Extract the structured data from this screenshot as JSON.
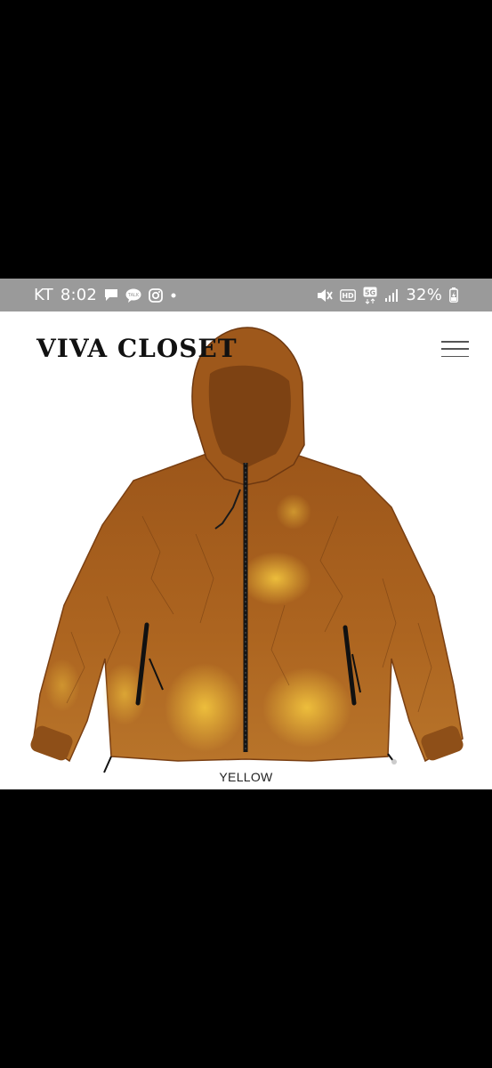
{
  "status_bar": {
    "carrier": "KT",
    "time": "8:02",
    "left_icons": [
      "chat-bubble-icon",
      "kakaotalk-icon",
      "instagram-icon",
      "dot-icon"
    ],
    "right_icons": [
      "mute-icon",
      "hd-icon",
      "5g-icon",
      "signal-icon"
    ],
    "battery": "32%",
    "background": "#9a9a9a"
  },
  "header": {
    "brand": "VIVA CLOSET",
    "menu_icon": "hamburger-menu-icon"
  },
  "product": {
    "caption": "YELLOW",
    "colors": {
      "jacket_base": "#a85f1c",
      "jacket_highlight": "#e0a83a",
      "zipper": "#151515"
    }
  }
}
